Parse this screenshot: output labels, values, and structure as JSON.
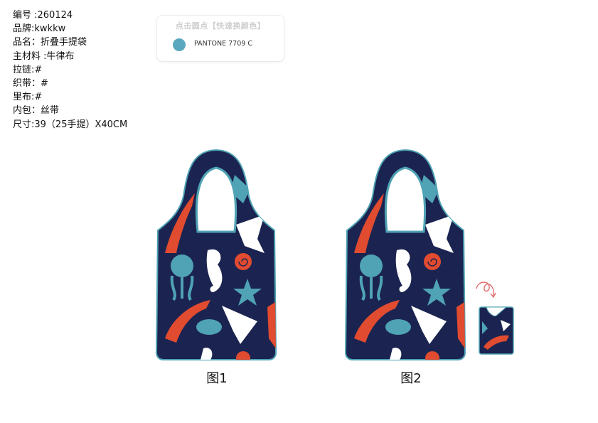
{
  "spec_lines": [
    "编号 :260124",
    "品牌:kwkkw",
    "品名：折叠手提袋",
    "主材料 :牛律布",
    "拉链:#",
    "织带：#",
    "里布:#",
    "内包：丝带",
    "尺寸:39（25手提）X40CM"
  ],
  "swatch": {
    "title": "点击圆点【快速换颜色】",
    "color_name": "PANTONE 7709 C",
    "color_hex": "#5aa8bf"
  },
  "colors": {
    "navy": "#1b2450",
    "teal": "#4fa3b4",
    "coral": "#e14b30",
    "white": "#ffffff",
    "arrow": "#e26a6a"
  },
  "figures": {
    "fig1_label": "图1",
    "fig2_label": "图2"
  }
}
